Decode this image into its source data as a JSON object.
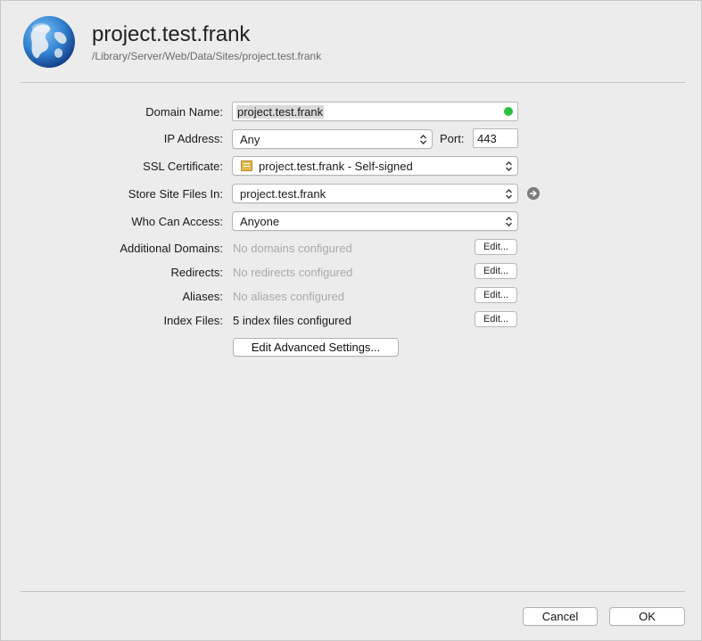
{
  "header": {
    "title": "project.test.frank",
    "path": "/Library/Server/Web/Data/Sites/project.test.frank",
    "icon": "globe-icon"
  },
  "form": {
    "domain_name": {
      "label": "Domain Name:",
      "value": "project.test.frank",
      "status_color": "#2bc13b"
    },
    "ip_address": {
      "label": "IP Address:",
      "value": "Any"
    },
    "port": {
      "label": "Port:",
      "value": "443"
    },
    "ssl_certificate": {
      "label": "SSL Certificate:",
      "value": "project.test.frank - Self-signed",
      "icon": "certificate-icon"
    },
    "store_site_files": {
      "label": "Store Site Files In:",
      "value": "project.test.frank"
    },
    "who_can_access": {
      "label": "Who Can Access:",
      "value": "Anyone"
    },
    "additional_domains": {
      "label": "Additional Domains:",
      "value": "No domains configured",
      "button": "Edit..."
    },
    "redirects": {
      "label": "Redirects:",
      "value": "No redirects configured",
      "button": "Edit..."
    },
    "aliases": {
      "label": "Aliases:",
      "value": "No aliases configured",
      "button": "Edit..."
    },
    "index_files": {
      "label": "Index Files:",
      "value": "5 index files configured",
      "button": "Edit..."
    },
    "advanced_button": "Edit Advanced Settings..."
  },
  "footer": {
    "cancel_label": "Cancel",
    "ok_label": "OK"
  }
}
